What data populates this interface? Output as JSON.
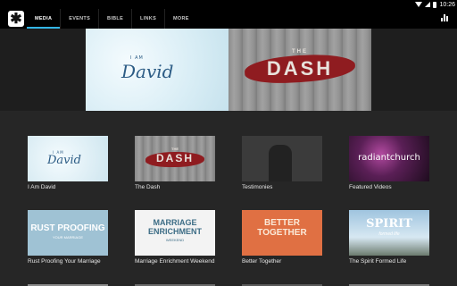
{
  "status_bar": {
    "time": "10:26"
  },
  "colors": {
    "accent": "#33b5e5",
    "app_bar": "#000000",
    "background": "#262626"
  },
  "app_bar": {
    "logo_icon": "asterisk-logo-icon",
    "tabs": [
      {
        "label": "MEDIA",
        "active": true
      },
      {
        "label": "EVENTS",
        "active": false
      },
      {
        "label": "BIBLE",
        "active": false
      },
      {
        "label": "LINKS",
        "active": false
      },
      {
        "label": "MORE",
        "active": false
      }
    ],
    "right_icon": "bar-chart-icon"
  },
  "hero": {
    "banners": [
      {
        "small": "I AM",
        "title": "David"
      },
      {
        "small": "THE",
        "title": "DASH"
      }
    ]
  },
  "grid": {
    "items": [
      {
        "title": "I Am David",
        "thumb_small": "I AM",
        "thumb_title": "David"
      },
      {
        "title": "The Dash",
        "thumb_small": "THE",
        "thumb_title": "DASH"
      },
      {
        "title": "Testimonies"
      },
      {
        "title": "Featured Videos",
        "thumb_title": "radiantchurch"
      },
      {
        "title": "Rust Proofing Your Marriage",
        "thumb_title": "RUST PROOFING",
        "thumb_sub": "YOUR MARRIAGE"
      },
      {
        "title": "Marriage Enrichment Weekend",
        "thumb_title": "MARRIAGE ENRICHMENT",
        "thumb_sub": "WEEKEND"
      },
      {
        "title": "Better Together",
        "thumb_title": "BETTER TOGETHER"
      },
      {
        "title": "The Spirit Formed Life",
        "thumb_title": "SPIRIT",
        "thumb_sub": "formed life"
      }
    ]
  }
}
